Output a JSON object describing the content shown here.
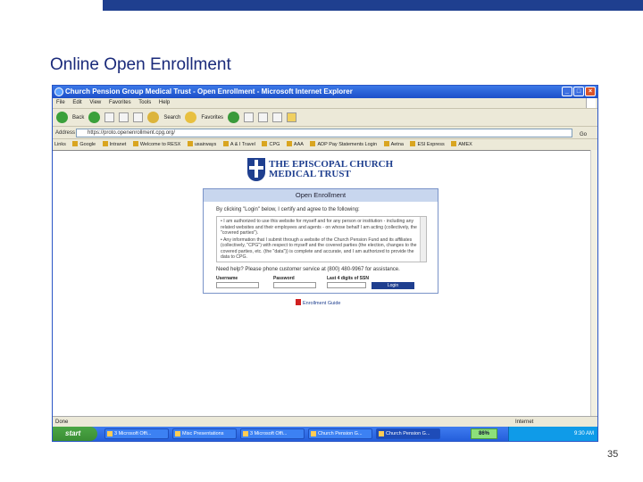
{
  "slide": {
    "title": "Online Open Enrollment",
    "page_number": "35"
  },
  "browser": {
    "window_title": "Church Pension Group Medical Trust - Open Enrollment - Microsoft Internet Explorer",
    "menu": [
      "File",
      "Edit",
      "View",
      "Favorites",
      "Tools",
      "Help"
    ],
    "toolbar": {
      "back": "Back",
      "search": "Search",
      "favorites": "Favorites"
    },
    "address_label": "Address",
    "address_value": "https://proto.openenrollment.cpg.org/",
    "go_label": "Go",
    "links_label": "Links",
    "links": [
      "Google",
      "Intranet",
      "Welcome to RESX",
      "usairways",
      "A & I Travel",
      "CPG",
      "AAA",
      "ADP Pay Statements Login",
      "Aetna",
      "ESI Express",
      "AMEX"
    ],
    "status_left": "Done",
    "status_zone": "Internet"
  },
  "page": {
    "logo_line1": "THE EPISCOPAL CHURCH",
    "logo_line2": "MEDICAL TRUST",
    "panel_title": "Open Enrollment",
    "intro": "By clicking \"Login\" below, I certify and agree to the following:",
    "terms": [
      "• I am authorized to use this website for myself and for any person or institution - including any related websites and their employees and agents - on whose behalf I am acting (collectively, the \"covered parties\").",
      "• Any information that I submit through a website of the Church Pension Fund and its affiliates (collectively, \"CPG\") with respect to myself and the covered parties (the election, changes to the covered parties, etc. (the \"data\")) is complete and accurate, and I am authorized to provide the data to CPG."
    ],
    "help_text": "Need help? Please phone customer service at (800) 480-9967 for assistance.",
    "username_label": "Username",
    "password_label": "Password",
    "ssn_label": "Last 4 digits of SSN",
    "login_label": "Login",
    "guide_link": "Enrollment Guide"
  },
  "taskbar": {
    "start": "start",
    "tasks": [
      "3 Microsoft Offi...",
      "Misc Presentations",
      "3 Microsoft Offi...",
      "Church Pension G...",
      "Church Pension G..."
    ],
    "zoom": "86%",
    "clock": "9:30 AM"
  },
  "colors": {
    "accent": "#1f3f8f",
    "titlebar": "#245edb",
    "start": "#3a8d35"
  }
}
